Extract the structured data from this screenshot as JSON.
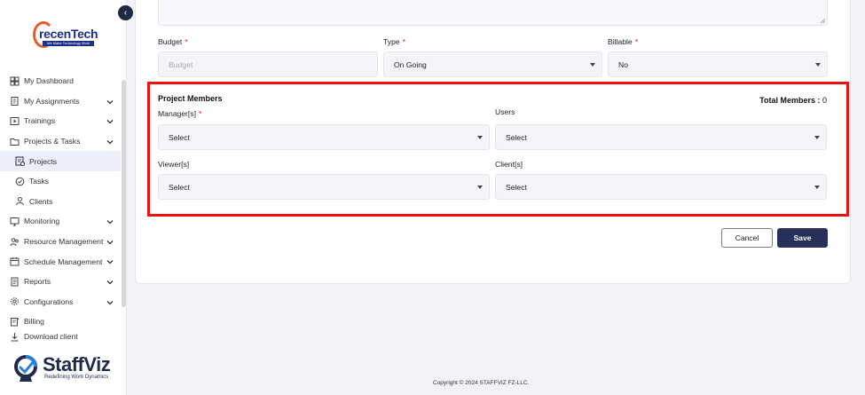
{
  "sidebar": {
    "logo_text": "recenTech",
    "logo_tagline": "We Make Technology Work",
    "items": [
      {
        "label": "My Dashboard",
        "icon": "dashboard-icon",
        "has_chevron": false
      },
      {
        "label": "My Assignments",
        "icon": "clipboard-icon",
        "has_chevron": true
      },
      {
        "label": "Trainings",
        "icon": "play-icon",
        "has_chevron": true
      },
      {
        "label": "Projects & Tasks",
        "icon": "folder-icon",
        "has_chevron": true
      },
      {
        "label": "Projects",
        "icon": "projects-icon",
        "has_chevron": false,
        "sub": true,
        "active": true
      },
      {
        "label": "Tasks",
        "icon": "check-circle-icon",
        "has_chevron": false,
        "sub": true
      },
      {
        "label": "Clients",
        "icon": "user-icon",
        "has_chevron": false,
        "sub": true
      },
      {
        "label": "Monitoring",
        "icon": "monitor-icon",
        "has_chevron": true
      },
      {
        "label": "Resource Management",
        "icon": "people-icon",
        "has_chevron": true
      },
      {
        "label": "Schedule Management",
        "icon": "calendar-icon",
        "has_chevron": true
      },
      {
        "label": "Reports",
        "icon": "report-icon",
        "has_chevron": true
      },
      {
        "label": "Configurations",
        "icon": "gear-icon",
        "has_chevron": true
      },
      {
        "label": "Billing",
        "icon": "billing-icon",
        "has_chevron": false
      },
      {
        "label": "Download client",
        "icon": "download-icon",
        "has_chevron": false,
        "partial": true
      }
    ],
    "brand_name": "StaffViz",
    "brand_tagline": "Redefining Work Dynamics"
  },
  "form": {
    "budget_label": "Budget",
    "budget_placeholder": "Budget",
    "type_label": "Type",
    "type_value": "On Going",
    "billable_label": "Billable",
    "billable_value": "No"
  },
  "members": {
    "title": "Project Members",
    "total_label": "Total Members : ",
    "total_value": "0",
    "managers_label": "Manager[s]",
    "managers_value": "Select",
    "users_label": "Users",
    "users_value": "Select",
    "viewers_label": "Viewer[s]",
    "viewers_value": "Select",
    "clients_label": "Client[s]",
    "clients_value": "Select"
  },
  "actions": {
    "cancel_label": "Cancel",
    "save_label": "Save"
  },
  "footer": {
    "copyright": "Copyright © 2024 STAFFVIZ FZ-LLC."
  },
  "colors": {
    "highlight": "#ea1111",
    "primary": "#26305a",
    "required": "#e11111",
    "logo_accent": "#e8592b",
    "logo_blue": "#1b2f8a"
  }
}
